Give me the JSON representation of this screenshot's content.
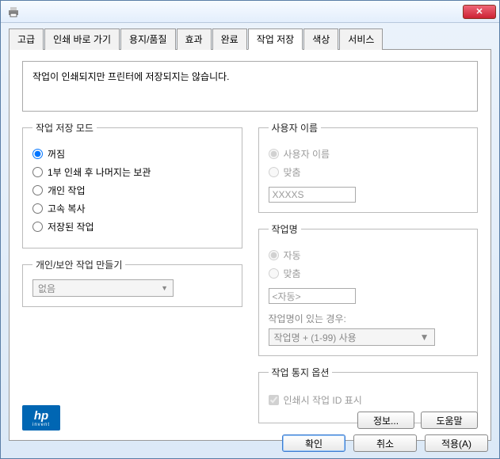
{
  "window": {
    "close_glyph": "✕"
  },
  "tabs": {
    "t0": "고급",
    "t1": "인쇄 바로 가기",
    "t2": "용지/품질",
    "t3": "효과",
    "t4": "완료",
    "t5": "작업 저장",
    "t6": "색상",
    "t7": "서비스"
  },
  "description": "작업이 인쇄되지만 프린터에 저장되지는 않습니다.",
  "job_storage_mode": {
    "legend": "작업 저장 모드",
    "opt_off": "꺼짐",
    "opt_proof": "1부 인쇄 후 나머지는 보관",
    "opt_personal": "개인 작업",
    "opt_quick": "고속 복사",
    "opt_stored": "저장된 작업"
  },
  "secure": {
    "legend": "개인/보안 작업 만들기",
    "select_value": "없음"
  },
  "username": {
    "legend": "사용자 이름",
    "opt_user": "사용자 이름",
    "opt_custom": "맞춤",
    "value": "XXXXS"
  },
  "jobname": {
    "legend": "작업명",
    "opt_auto": "자동",
    "opt_custom": "맞춤",
    "value": "<자동>",
    "exists_label": "작업명이 있는 경우:",
    "exists_value": "작업명 + (1-99) 사용"
  },
  "notify": {
    "legend": "작업 통지 옵션",
    "chk_label": "인쇄시 작업 ID 표시"
  },
  "panel_buttons": {
    "info": "정보...",
    "help": "도움말"
  },
  "footer": {
    "ok": "확인",
    "cancel": "취소",
    "apply": "적용(A)"
  },
  "hp": {
    "text": "hp",
    "sub": "invent"
  }
}
